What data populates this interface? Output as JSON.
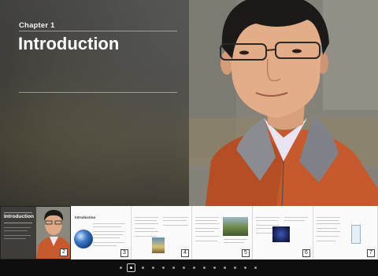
{
  "chapter": {
    "label": "Chapter 1",
    "title": "Introduction"
  },
  "filmstrip": {
    "current_thumb_title": "Introduction",
    "current_page": "2",
    "pages": [
      {
        "number": "3",
        "heading": "Introduction"
      },
      {
        "number": "4"
      },
      {
        "number": "5"
      },
      {
        "number": "6"
      },
      {
        "number": "7"
      }
    ]
  },
  "navigation": {
    "dot_count": 15,
    "current_index": 1
  },
  "colors": {
    "accent_shirt": "#c65a2c",
    "background": "#111111"
  }
}
